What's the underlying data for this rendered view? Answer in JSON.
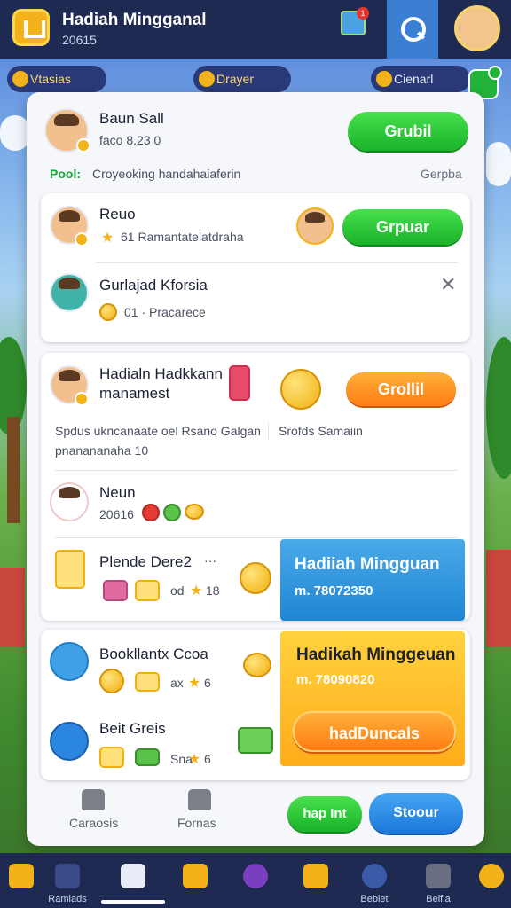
{
  "header": {
    "title": "Hadiah Mingganal",
    "subtitle": "20615",
    "notification_count": "1"
  },
  "chips": [
    "Vtasias",
    "Drayer",
    "Cienarl"
  ],
  "panel": {
    "top": {
      "name": "Baun Sall",
      "meta": "faco 8.23  0",
      "button": "Grubil",
      "note_label": "Pool:",
      "note_text": "Croyeoking handahaiaferin",
      "note_right": "Gerpba"
    },
    "card1": {
      "row1": {
        "name": "Reuo",
        "meta": "61  Ramantatelatdraha",
        "button": "Grpuar"
      },
      "row2": {
        "name": "Gurlajad Kforsia",
        "meta": "01 · Pracarece"
      }
    },
    "card2": {
      "row1": {
        "name_line1": "Hadialn Hadkkann",
        "name_line2": "manamest",
        "button": "Grollil"
      },
      "desc_line1": "Spdus ukncanaate oel Rsano Galgan",
      "desc_line2": "pnanananaha 10",
      "desc_right": "Srofds Samaiin",
      "row2": {
        "name": "Neun",
        "meta": "20616"
      },
      "row3": {
        "name": "Plende Dere2",
        "arrow": "···",
        "meta": "od",
        "meta_tail": "18"
      },
      "promo": {
        "title": "Hadiiah Mingguan",
        "value": "m. 78072350"
      }
    },
    "card3": {
      "row1": {
        "name": "Bookllantx Ccoa",
        "meta": "ax",
        "meta_tail": "6"
      },
      "row2": {
        "name": "Beit Greis",
        "meta": "Sna",
        "meta_tail": "6"
      },
      "promo": {
        "title": "Hadikah Minggeuan",
        "value": "m. 78090820",
        "button": "hadDuncals"
      }
    },
    "footer": {
      "item1": "Caraosis",
      "item2": "Fornas",
      "btn_green": "hap Int",
      "btn_blue": "Stoour"
    }
  },
  "bottom_nav": [
    "",
    "Ramiads",
    "",
    "",
    "",
    "",
    "Bebiet",
    "Beifla",
    ""
  ],
  "colors": {
    "nav_bg": "#1f2a52",
    "accent_green": "#19b22a",
    "accent_orange": "#ff7c14",
    "accent_blue": "#1f86d4",
    "accent_yellow": "#ffac1a"
  }
}
